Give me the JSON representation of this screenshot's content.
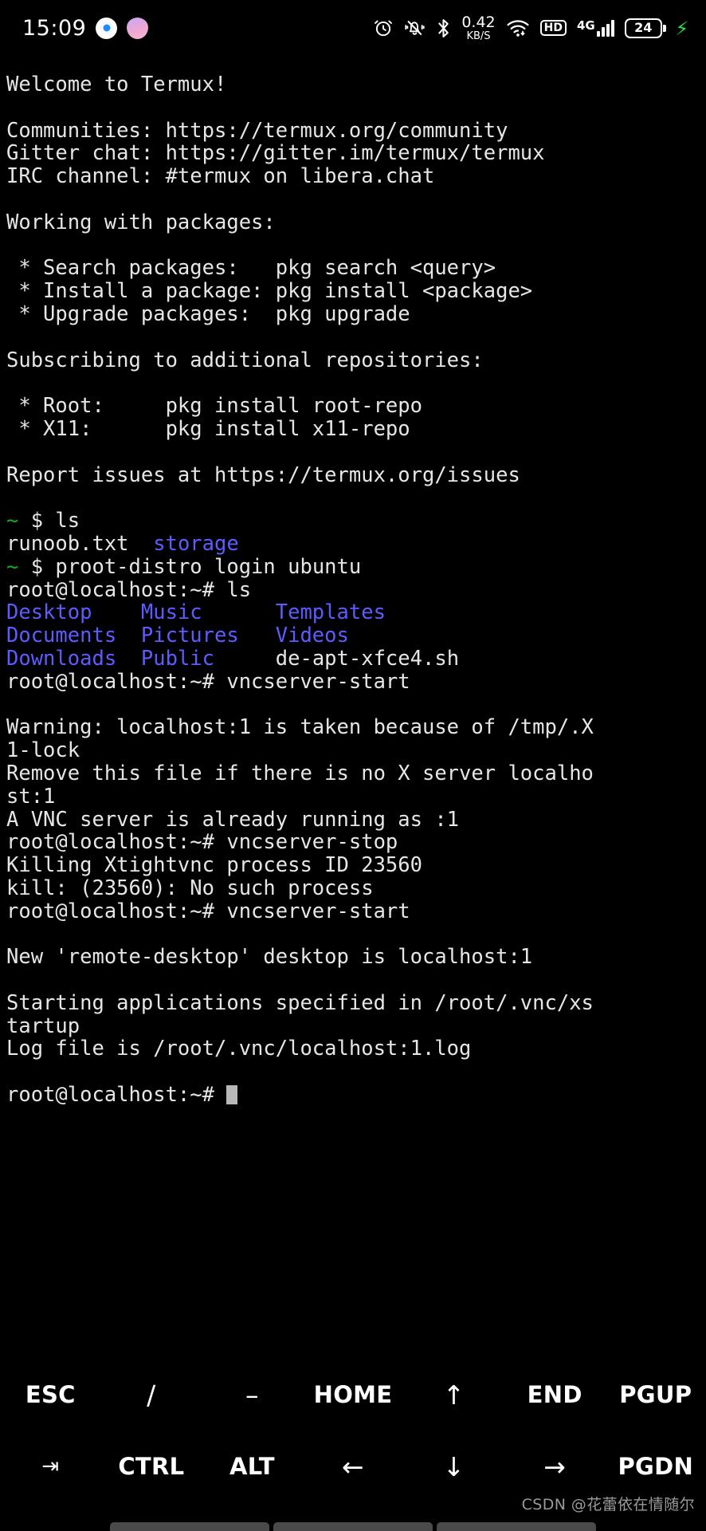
{
  "status_bar": {
    "clock": "15:09",
    "left_icons": [
      {
        "name": "app-indicator-blue",
        "label": "app-indicator"
      },
      {
        "name": "app-indicator-pink",
        "label": "app-indicator"
      }
    ],
    "alarm_icon": "alarm-icon",
    "mute_icon": "bell-muted-icon",
    "bluetooth_icon": "bluetooth-icon",
    "network_speed_value": "0.42",
    "network_speed_unit": "KB/S",
    "wifi_icon": "wifi-icon",
    "hd_badge": "HD",
    "signal_generation": "4G",
    "battery_percent": "24",
    "charging_icon": "charging-bolt-icon"
  },
  "terminal": {
    "lines": [
      [
        {
          "t": "Welcome to Termux!",
          "c": "white"
        }
      ],
      [],
      [
        {
          "t": "Communities: https://termux.org/community",
          "c": "white"
        }
      ],
      [
        {
          "t": "Gitter chat: https://gitter.im/termux/termux",
          "c": "white"
        }
      ],
      [
        {
          "t": "IRC channel: #termux on libera.chat",
          "c": "white"
        }
      ],
      [],
      [
        {
          "t": "Working with packages:",
          "c": "white"
        }
      ],
      [],
      [
        {
          "t": " * Search packages:   pkg search <query>",
          "c": "white"
        }
      ],
      [
        {
          "t": " * Install a package: pkg install <package>",
          "c": "white"
        }
      ],
      [
        {
          "t": " * Upgrade packages:  pkg upgrade",
          "c": "white"
        }
      ],
      [],
      [
        {
          "t": "Subscribing to additional repositories:",
          "c": "white"
        }
      ],
      [],
      [
        {
          "t": " * Root:     pkg install root-repo",
          "c": "white"
        }
      ],
      [
        {
          "t": " * X11:      pkg install x11-repo",
          "c": "white"
        }
      ],
      [],
      [
        {
          "t": "Report issues at https://termux.org/issues",
          "c": "white"
        }
      ],
      [],
      [
        {
          "t": "~",
          "c": "green"
        },
        {
          "t": " $ ls",
          "c": "white"
        }
      ],
      [
        {
          "t": "runoob.txt  ",
          "c": "white"
        },
        {
          "t": "storage",
          "c": "blue"
        }
      ],
      [
        {
          "t": "~",
          "c": "green"
        },
        {
          "t": " $ proot-distro login ubuntu",
          "c": "white"
        }
      ],
      [
        {
          "t": "root@localhost:~# ls",
          "c": "white"
        }
      ],
      [
        {
          "t": "Desktop    Music      Templates",
          "c": "blue"
        }
      ],
      [
        {
          "t": "Documents  Pictures   Videos",
          "c": "blue"
        }
      ],
      [
        {
          "t": "Downloads  Public",
          "c": "blue"
        },
        {
          "t": "     de-apt-xfce4.sh",
          "c": "white"
        }
      ],
      [
        {
          "t": "root@localhost:~# vncserver-start",
          "c": "white"
        }
      ],
      [],
      [
        {
          "t": "Warning: localhost:1 is taken because of /tmp/.X",
          "c": "white"
        }
      ],
      [
        {
          "t": "1-lock",
          "c": "white"
        }
      ],
      [
        {
          "t": "Remove this file if there is no X server localho",
          "c": "white"
        }
      ],
      [
        {
          "t": "st:1",
          "c": "white"
        }
      ],
      [
        {
          "t": "A VNC server is already running as :1",
          "c": "white"
        }
      ],
      [
        {
          "t": "root@localhost:~# vncserver-stop",
          "c": "white"
        }
      ],
      [
        {
          "t": "Killing Xtightvnc process ID 23560",
          "c": "white"
        }
      ],
      [
        {
          "t": "kill: (23560): No such process",
          "c": "white"
        }
      ],
      [
        {
          "t": "root@localhost:~# vncserver-start",
          "c": "white"
        }
      ],
      [],
      [
        {
          "t": "New 'remote-desktop' desktop is localhost:1",
          "c": "white"
        }
      ],
      [],
      [
        {
          "t": "Starting applications specified in /root/.vnc/xs",
          "c": "white"
        }
      ],
      [
        {
          "t": "tartup",
          "c": "white"
        }
      ],
      [
        {
          "t": "Log file is /root/.vnc/localhost:1.log",
          "c": "white"
        }
      ],
      [],
      [
        {
          "t": "root@localhost:~# ",
          "c": "white"
        },
        {
          "t": "",
          "c": "cursor"
        }
      ]
    ]
  },
  "extra_keys": {
    "row1": [
      {
        "label": "ESC",
        "name": "key-esc",
        "kind": "text"
      },
      {
        "label": "/",
        "name": "key-slash",
        "kind": "sym"
      },
      {
        "label": "–",
        "label_name": "dash",
        "name": "key-dash",
        "kind": "sym"
      },
      {
        "label": "HOME",
        "name": "key-home",
        "kind": "text"
      },
      {
        "label": "↑",
        "name": "key-arrow-up",
        "kind": "arrow"
      },
      {
        "label": "END",
        "name": "key-end",
        "kind": "text"
      },
      {
        "label": "PGUP",
        "name": "key-pgup",
        "kind": "text"
      }
    ],
    "row2": [
      {
        "label": "⇥",
        "name": "key-tab",
        "kind": "tabicon"
      },
      {
        "label": "CTRL",
        "name": "key-ctrl",
        "kind": "text"
      },
      {
        "label": "ALT",
        "name": "key-alt",
        "kind": "text"
      },
      {
        "label": "←",
        "name": "key-arrow-left",
        "kind": "arrow"
      },
      {
        "label": "↓",
        "name": "key-arrow-down",
        "kind": "arrow"
      },
      {
        "label": "→",
        "name": "key-arrow-right",
        "kind": "arrow"
      },
      {
        "label": "PGDN",
        "name": "key-pgdn",
        "kind": "text"
      }
    ]
  },
  "watermark": {
    "text": "CSDN @花蕾依在情随尔"
  },
  "colors": {
    "background": "#000000",
    "foreground": "#e6e6e6",
    "prompt_green": "#1aa81a",
    "dir_blue": "#5c5cff",
    "charge_green": "#22e34a",
    "cursor_gray": "#b8b8b8"
  },
  "nav_bar": {
    "items": [
      "back",
      "home",
      "recent"
    ]
  }
}
